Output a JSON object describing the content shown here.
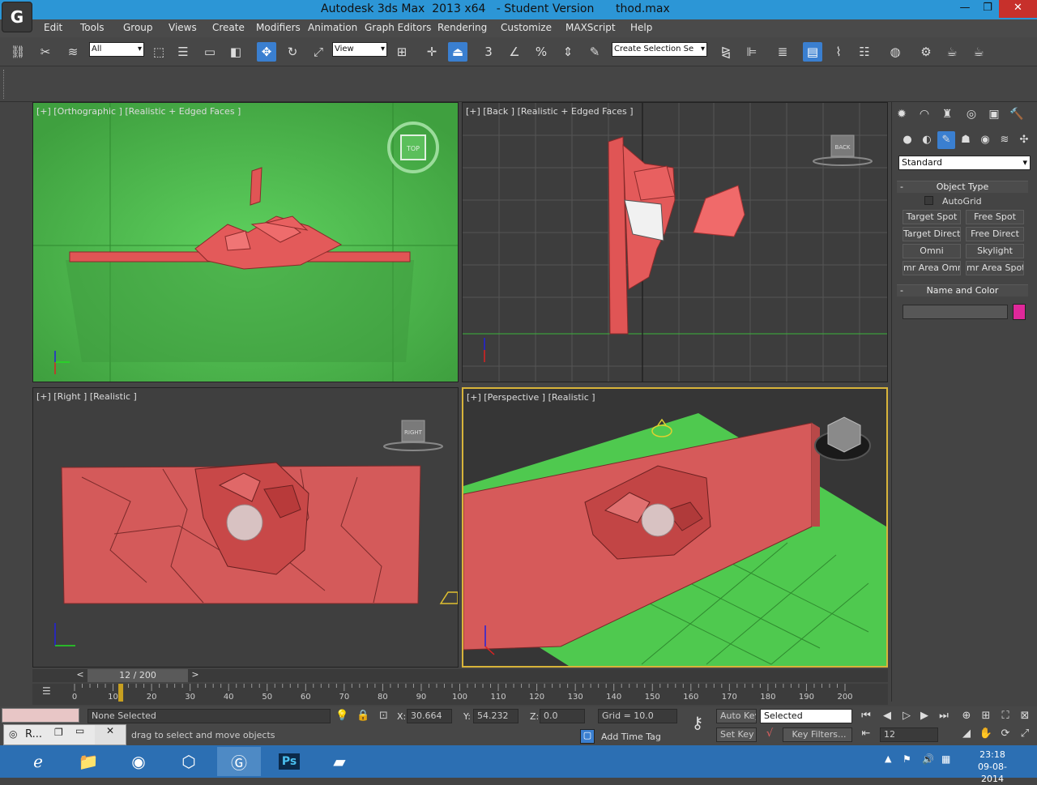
{
  "window": {
    "title": "Autodesk 3ds Max  2013 x64   - Student Version      thod.max",
    "logo": "G",
    "minimize": "—",
    "restore": "❐",
    "close": "✕"
  },
  "menu": [
    "Edit",
    "Tools",
    "Group",
    "Views",
    "Create",
    "Modifiers",
    "Animation",
    "Graph Editors",
    "Rendering",
    "Customize",
    "MAXScript",
    "Help"
  ],
  "toolbar": {
    "selection_filter": "All",
    "reference_coord": "View",
    "named_selection": "Create Selection Se"
  },
  "viewports": {
    "top_left": "[+] [Orthographic ] [Realistic + Edged Faces ]",
    "top_right": "[+] [Back ] [Realistic + Edged Faces ]",
    "bottom_left": "[+] [Right ] [Realistic ]",
    "bottom_right": "[+] [Perspective ] [Realistic ]",
    "viewcube_top": "TOP",
    "viewcube_back": "BACK",
    "viewcube_right": "RIGHT"
  },
  "command_panel": {
    "category": "Standard",
    "object_type_title": "Object Type",
    "autogrid": "AutoGrid",
    "buttons": [
      "Target Spot",
      "Free Spot",
      "Target Direct",
      "Free Direct",
      "Omni",
      "Skylight",
      "mr Area Omni",
      "mr Area Spot"
    ],
    "name_color_title": "Name and Color",
    "object_color": "#e0289a"
  },
  "timeline": {
    "frame_counter": "12 / 200",
    "current_frame": 12,
    "total_frames": 200,
    "ticks": [
      "0",
      "10",
      "20",
      "30",
      "40",
      "50",
      "60",
      "70",
      "80",
      "90",
      "100",
      "110",
      "120",
      "130",
      "140",
      "150",
      "160",
      "170",
      "180",
      "190",
      "200"
    ]
  },
  "status": {
    "selection": "None Selected",
    "prompt": "drag to select and move objects",
    "x_label": "X:",
    "x_value": "30.664",
    "y_label": "Y:",
    "y_value": "54.232",
    "z_label": "Z:",
    "z_value": "0.0",
    "grid": "Grid = 10.0",
    "add_time_tag": "Add Time Tag",
    "auto_key": "Auto Key",
    "set_key": "Set Key",
    "key_mode": "Selected",
    "key_filters": "Key Filters...",
    "current_frame_field": "12"
  },
  "taskbar": {
    "mini_window_label": "R...",
    "clock_time": "23:18",
    "clock_date": "09-08-2014"
  }
}
